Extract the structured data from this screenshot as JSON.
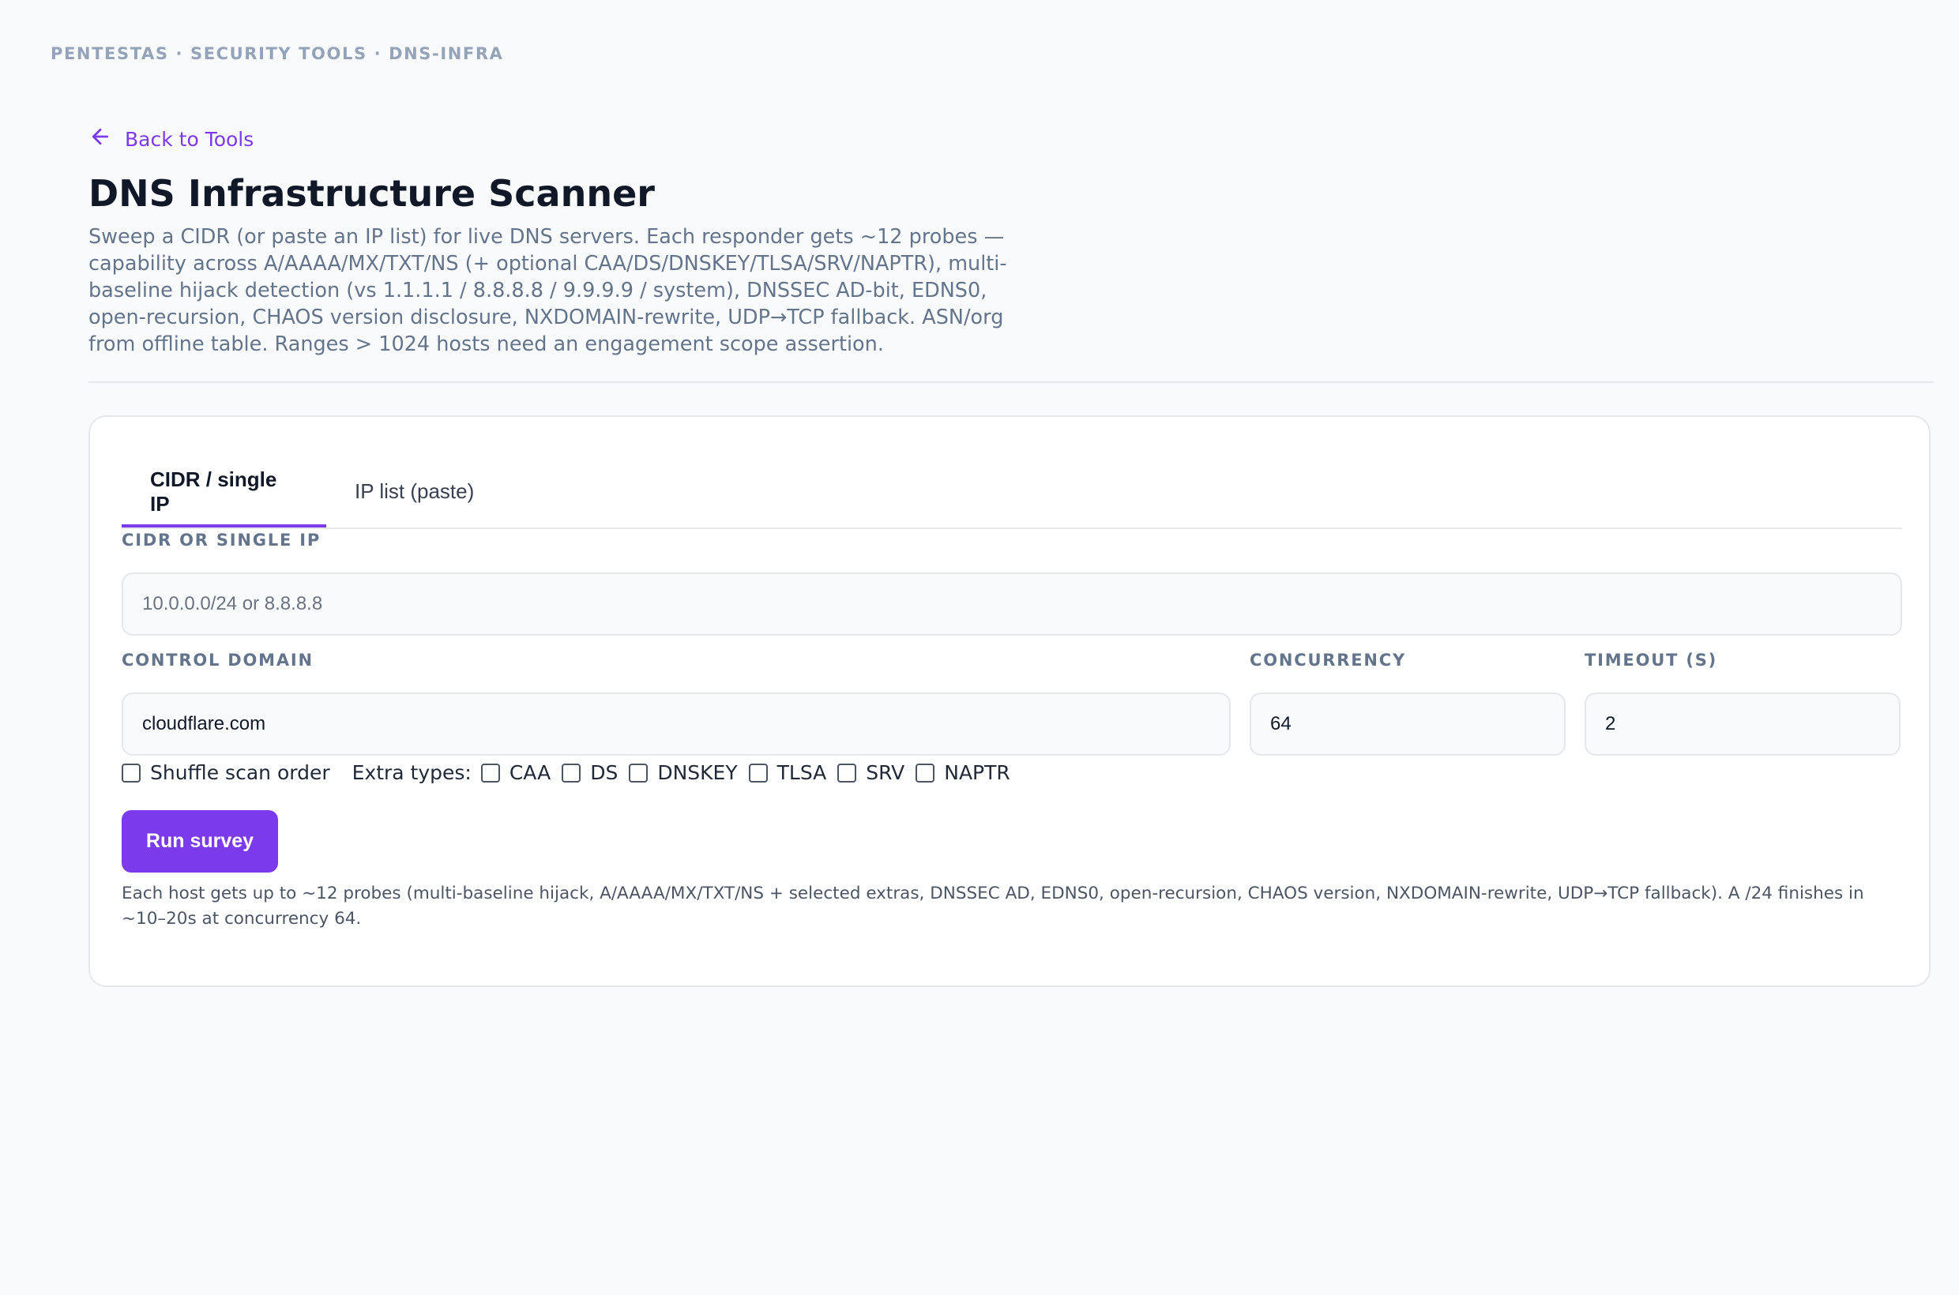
{
  "breadcrumb": "PENTESTAS · SECURITY TOOLS · DNS-INFRA",
  "back_link": "Back to Tools",
  "title": "DNS Infrastructure Scanner",
  "description": "Sweep a CIDR (or paste an IP list) for live DNS servers. Each responder gets ~12 probes — capability across A/AAAA/MX/TXT/NS (+ optional CAA/DS/DNSKEY/TLSA/SRV/NAPTR), multi-baseline hijack detection (vs 1.1.1.1 / 8.8.8.8 / 9.9.9.9 / system), DNSSEC AD-bit, EDNS0, open-recursion, CHAOS version disclosure, NXDOMAIN-rewrite, UDP→TCP fallback. ASN/org from offline table. Ranges > 1024 hosts need an engagement scope assertion.",
  "tabs": [
    {
      "label": "CIDR / single IP",
      "active": true
    },
    {
      "label": "IP list (paste)",
      "active": false
    }
  ],
  "form": {
    "cidr_label": "CIDR OR SINGLE IP",
    "cidr_placeholder": "10.0.0.0/24 or 8.8.8.8",
    "control_domain_label": "CONTROL DOMAIN",
    "control_domain_value": "cloudflare.com",
    "concurrency_label": "CONCURRENCY",
    "concurrency_value": "64",
    "timeout_label": "TIMEOUT (S)",
    "timeout_value": "2",
    "shuffle_label": "Shuffle scan order",
    "extra_types_label": "Extra types:",
    "extra_types": [
      "CAA",
      "DS",
      "DNSKEY",
      "TLSA",
      "SRV",
      "NAPTR"
    ],
    "run_button": "Run survey",
    "note": "Each host gets up to ~12 probes (multi-baseline hijack, A/AAAA/MX/TXT/NS + selected extras, DNSSEC AD, EDNS0, open-recursion, CHAOS version, NXDOMAIN-rewrite, UDP→TCP fallback). A /24 finishes in ~10–20s at concurrency 64."
  },
  "colors": {
    "accent": "#7c3aed",
    "background": "#f9fafb",
    "muted_text": "#64748b"
  },
  "icons": {
    "back": "arrow-left-icon"
  }
}
